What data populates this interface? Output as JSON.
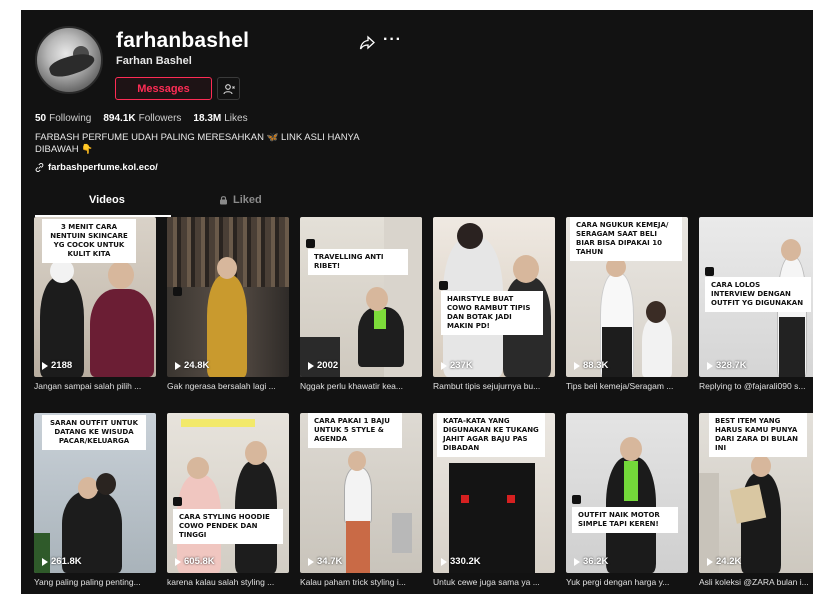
{
  "profile": {
    "username": "farhanbashel",
    "display_name": "Farhan Bashel",
    "messages_label": "Messages",
    "following_count": "50",
    "following_label": "Following",
    "followers_count": "894.1K",
    "followers_label": "Followers",
    "likes_count": "18.3M",
    "likes_label": "Likes",
    "bio": "FARBASH PERFUME UDAH PALING MERESAHKAN 🦋 LINK ASLI HANYA DIBAWAH 👇",
    "link": "farbashperfume.kol.eco/"
  },
  "tabs": [
    {
      "label": "Videos",
      "active": true
    },
    {
      "label": "Liked",
      "active": false
    }
  ],
  "colors": {
    "accent": "#fe2c55",
    "background": "#121212"
  },
  "videos": [
    {
      "views": "2188",
      "caption": "Jangan sampai salah pilih ...",
      "overlay": "3 MENIT CARA NENTUIN SKINCARE YG COCOK UNTUK KULIT KITA"
    },
    {
      "views": "24.8K",
      "caption": "Gak ngerasa bersalah lagi ...",
      "overlay": ""
    },
    {
      "views": "2002",
      "caption": "Nggak perlu khawatir kea...",
      "overlay": "TRAVELLING ANTI RIBET!"
    },
    {
      "views": "237K",
      "caption": "Rambut tipis sejujurnya bu...",
      "overlay": "HAIRSTYLE BUAT COWO RAMBUT TIPIS DAN BOTAK JADI MAKIN PD!"
    },
    {
      "views": "88.3K",
      "caption": "Tips beli kemeja/Seragam ...",
      "overlay": "CARA NGUKUR KEMEJA/ SERAGAM SAAT BELI BIAR BISA DIPAKAI 10 TAHUN"
    },
    {
      "views": "328.7K",
      "caption": "Replying to @fajarali090 s...",
      "overlay": "CARA LOLOS INTERVIEW DENGAN OUTFIT YG DIGUNAKAN"
    },
    {
      "views": "261.8K",
      "caption": "Yang paling paling penting...",
      "overlay": "SARAN OUTFIT UNTUK DATANG KE WISUDA PACAR/KELUARGA"
    },
    {
      "views": "605.8K",
      "caption": "karena kalau salah styling ...",
      "overlay": "CARA STYLING HOODIE COWO PENDEK DAN TINGGI"
    },
    {
      "views": "34.7K",
      "caption": "Kalau paham trick styling i...",
      "overlay": "CARA PAKAI 1 BAJU UNTUK 5 STYLE & AGENDA"
    },
    {
      "views": "330.2K",
      "caption": "Untuk cewe juga sama ya ...",
      "overlay": "KATA-KATA YANG DIGUNAKAN KE TUKANG JAHIT AGAR BAJU PAS DIBADAN"
    },
    {
      "views": "36.2K",
      "caption": "Yuk pergi dengan harga y...",
      "overlay": "OUTFIT NAIK MOTOR SIMPLE TAPI KEREN!"
    },
    {
      "views": "24.2K",
      "caption": "Asli koleksi @ZARA bulan i...",
      "overlay": "BEST ITEM YANG HARUS KAMU PUNYA DARI ZARA DI BULAN INI"
    }
  ]
}
